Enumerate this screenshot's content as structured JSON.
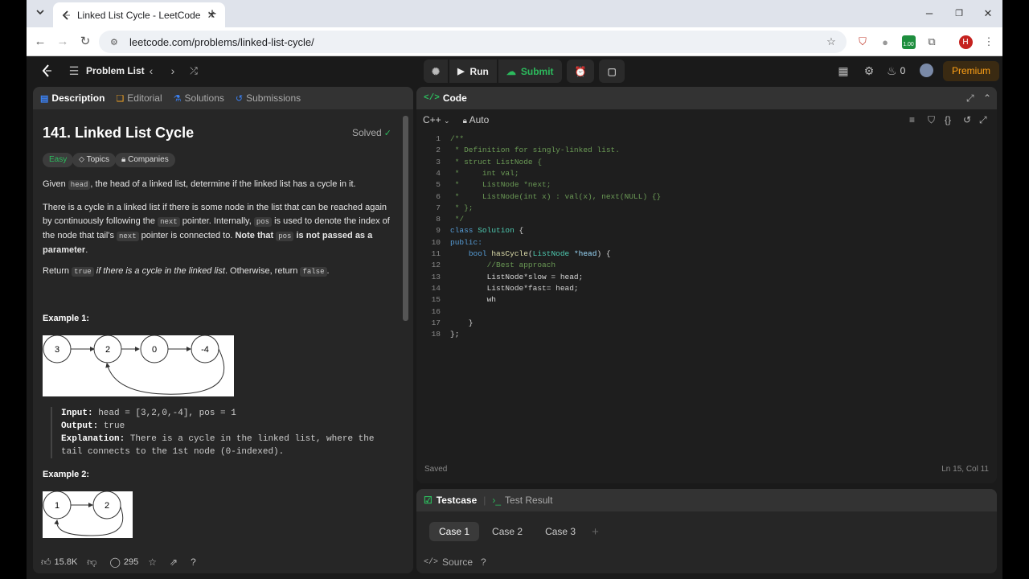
{
  "browser": {
    "tab_title": "Linked List Cycle - LeetCode",
    "url": "leetcode.com/problems/linked-list-cycle/",
    "profile_initial": "H",
    "ext_badge": "1.00"
  },
  "nav": {
    "problem_list": "Problem List",
    "run": "Run",
    "submit": "Submit",
    "streak_count": "0",
    "premium": "Premium"
  },
  "left_tabs": [
    "Description",
    "Editorial",
    "Solutions",
    "Submissions"
  ],
  "problem": {
    "title": "141. Linked List Cycle",
    "status": "Solved",
    "difficulty": "Easy",
    "topics": "Topics",
    "companies": "Companies",
    "p1": [
      "Given ",
      "head",
      ", the head of a linked list, determine if the linked list has a cycle in it."
    ],
    "p2_a": "There is a cycle in a linked list if there is some node in the list that can be reached again by continuously following the ",
    "p2_next": "next",
    "p2_b": " pointer. Internally, ",
    "p2_pos": "pos",
    "p2_c": " is used to denote the index of the node that tail's ",
    "p2_next2": "next",
    "p2_d": " pointer is connected to. ",
    "p2_e": "Note that ",
    "p2_pos2": "pos",
    "p2_f": " is not passed as a parameter",
    "p2_g": ".",
    "p3": [
      "Return ",
      "true",
      " if there is a cycle in the linked list",
      ". Otherwise, return ",
      "false",
      "."
    ],
    "example1": {
      "heading": "Example 1:",
      "nodes": [
        "3",
        "2",
        "0",
        "-4"
      ],
      "input_label": "Input:",
      "input": " head = [3,2,0,-4], pos = 1",
      "output_label": "Output:",
      "output": " true",
      "expl_label": "Explanation:",
      "expl": " There is a cycle in the linked list, where the tail connects to the 1st node (0-indexed)."
    },
    "example2": {
      "heading": "Example 2:",
      "nodes": [
        "1",
        "2"
      ]
    }
  },
  "footer": {
    "likes": "15.8K",
    "comments": "295"
  },
  "code": {
    "header": "Code",
    "language": "C++",
    "mode": "Auto",
    "status": "Saved",
    "cursor": "Ln 15, Col 11",
    "lines": [
      [
        [
          "/**",
          "cm"
        ]
      ],
      [
        [
          " * Definition for singly-linked list.",
          "cm"
        ]
      ],
      [
        [
          " * struct ListNode {",
          "cm"
        ]
      ],
      [
        [
          " *     int val;",
          "cm"
        ]
      ],
      [
        [
          " *     ListNode *next;",
          "cm"
        ]
      ],
      [
        [
          " *     ListNode(int x) : val(x), next(NULL) {}",
          "cm"
        ]
      ],
      [
        [
          " * };",
          "cm"
        ]
      ],
      [
        [
          " */",
          "cm"
        ]
      ],
      [
        [
          "class ",
          "kw"
        ],
        [
          "Solution",
          "ty"
        ],
        [
          " {",
          ""
        ]
      ],
      [
        [
          "public:",
          "kw"
        ]
      ],
      [
        [
          "    ",
          ""
        ],
        [
          "bool ",
          "kw"
        ],
        [
          "hasCycle",
          "fn"
        ],
        [
          "(",
          ""
        ],
        [
          "ListNode ",
          "ty"
        ],
        [
          "*head",
          "pa"
        ],
        [
          ") {",
          ""
        ]
      ],
      [
        [
          "        ",
          ""
        ],
        [
          "//Best approach",
          "cm"
        ]
      ],
      [
        [
          "        ListNode*slow = head;",
          ""
        ]
      ],
      [
        [
          "        ListNode*fast= head;",
          ""
        ]
      ],
      [
        [
          "        wh",
          ""
        ]
      ],
      [
        [
          "",
          ""
        ]
      ],
      [
        [
          "    }",
          ""
        ]
      ],
      [
        [
          "};",
          ""
        ]
      ]
    ]
  },
  "testcase": {
    "tab1": "Testcase",
    "tab2": "Test Result",
    "cases": [
      "Case 1",
      "Case 2",
      "Case 3"
    ],
    "source": "Source"
  }
}
